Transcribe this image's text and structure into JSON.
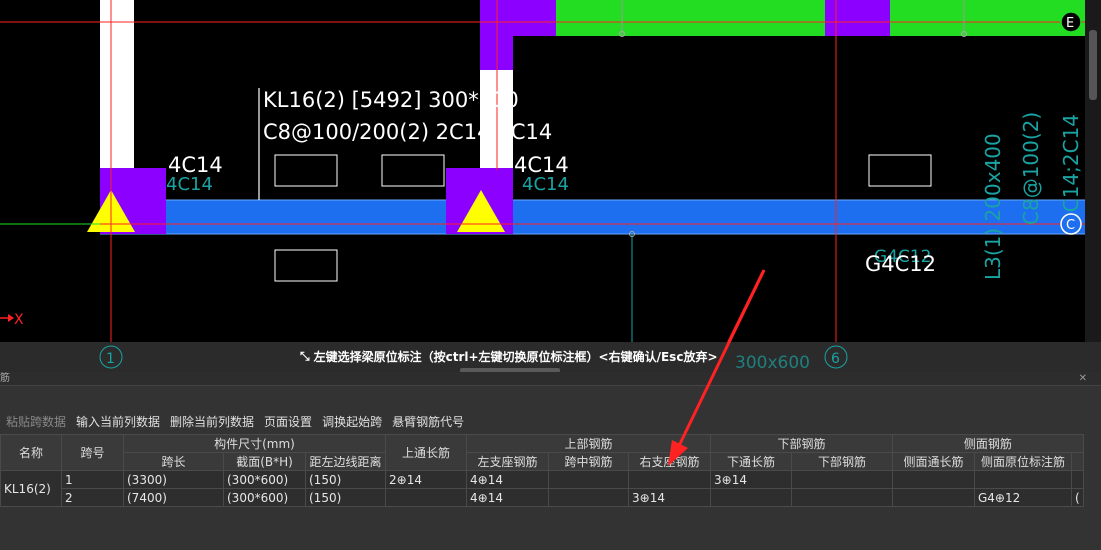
{
  "cad": {
    "beam_label_line1": "KL16(2) [5492] 300*600",
    "beam_label_line2": "C8@100/200(2) 2C14;3C14",
    "support_rebar_left": "4C14",
    "support_rebar_left_ghost": "4C14",
    "support_rebar_mid": "4C14",
    "support_rebar_mid_ghost": "4C14",
    "side_rebar": "G4C12",
    "side_rebar_ghost": "G4C12",
    "vertical_label_1": "L3(1) 200x400",
    "vertical_label_2": "C8@100(2)",
    "vertical_label_3": "2C14;2C14",
    "bottom_ghost_label": "300x600",
    "axis_E": "E",
    "axis_C": "C",
    "axis_1": "1",
    "axis_6": "6",
    "x_axis_label": "X",
    "colors": {
      "beam": "#1e6ef0",
      "column": "#8b00ff",
      "slab": "#22dd22",
      "grid": "#ff2222",
      "wall": "#ffffff",
      "support": "#ffff00",
      "ghost": "#1aa3a3"
    }
  },
  "status": {
    "icon": "collapse-arrows-icon",
    "message": "左键选择梁原位标注（按ctrl+左键切换原位标注框）<右键确认/Esc放弃>"
  },
  "panel": {
    "title": "筋",
    "close_icon": "close-icon"
  },
  "toolbar": {
    "paste": "粘贴跨数据",
    "input_col": "输入当前列数据",
    "delete_col": "删除当前列数据",
    "page_setup": "页面设置",
    "swap_start": "调换起始跨",
    "cantilever_code": "悬臂钢筋代号"
  },
  "table": {
    "headers": {
      "name": "名称",
      "span_no": "跨号",
      "size_group": "构件尺寸(mm)",
      "span_len": "跨长",
      "section": "截面(B*H)",
      "left_dist": "距左边线距离",
      "top_through": "上通长筋",
      "top_group": "上部钢筋",
      "top_left": "左支座钢筋",
      "top_mid": "跨中钢筋",
      "top_right": "右支座钢筋",
      "bottom_group": "下部钢筋",
      "bot_through": "下通长筋",
      "bot_rebar": "下部钢筋",
      "side_group": "侧面钢筋",
      "side_through": "侧面通长筋",
      "side_orig": "侧面原位标注筋"
    },
    "rows": [
      {
        "name": "KL16(2)",
        "span_no": "1",
        "span_len": "(3300)",
        "section": "(300*600)",
        "left_dist": "(150)",
        "top_through": "2⊕14",
        "top_left": "4⊕14",
        "top_mid": "",
        "top_right": "",
        "bot_through": "3⊕14",
        "bot_rebar": "",
        "side_through": "",
        "side_orig": ""
      },
      {
        "name": "",
        "span_no": "2",
        "span_len": "(7400)",
        "section": "(300*600)",
        "left_dist": "(150)",
        "top_through": "",
        "top_left": "4⊕14",
        "top_mid": "",
        "top_right": "3⊕14",
        "bot_through": "",
        "bot_rebar": "",
        "side_through": "",
        "side_orig": "G4⊕12"
      }
    ]
  }
}
